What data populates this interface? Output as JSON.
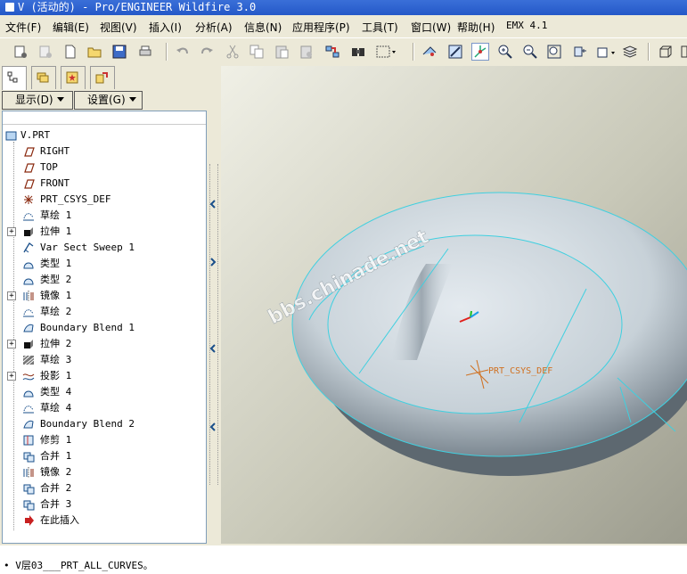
{
  "window": {
    "title": "V (活动的) - Pro/ENGINEER Wildfire 3.0"
  },
  "menu": [
    "文件(F)",
    "编辑(E)",
    "视图(V)",
    "插入(I)",
    "分析(A)",
    "信息(N)",
    "应用程序(P)",
    "工具(T)",
    "窗口(W)",
    "帮助(H)",
    "EMX 4.1"
  ],
  "toolbar": {
    "icons": [
      "new-session-icon",
      "open-file-disabled-icon",
      "new-file-icon",
      "open-folder-icon",
      "save-icon",
      "print-icon",
      "undo-icon",
      "redo-icon",
      "cut-icon",
      "copy-icon",
      "paste-icon",
      "paste-special-icon",
      "regenerate-icon",
      "find-icon",
      "select-box-icon",
      "refit-icon",
      "repaint-icon",
      "spin-center-icon",
      "zoom-in-icon",
      "zoom-out-icon",
      "zoom-fit-icon",
      "orient-icon",
      "saved-views-icon",
      "layers-icon",
      "display-style-icon"
    ],
    "pressed": "spin-center-icon"
  },
  "left_panel": {
    "tabs": [
      "model-tree-tab",
      "layer-tree-tab",
      "favorites-tab",
      "connections-tab"
    ],
    "display_label": "显示(D)",
    "settings_label": "设置(G)"
  },
  "tree": {
    "root": "V.PRT",
    "items": [
      {
        "label": "RIGHT",
        "icon": "datum-plane-icon",
        "expand": false
      },
      {
        "label": "TOP",
        "icon": "datum-plane-icon",
        "expand": false
      },
      {
        "label": "FRONT",
        "icon": "datum-plane-icon",
        "expand": false
      },
      {
        "label": "PRT_CSYS_DEF",
        "icon": "csys-icon",
        "expand": false
      },
      {
        "label": "草绘 1",
        "icon": "sketch-icon",
        "expand": false
      },
      {
        "label": "拉伸 1",
        "icon": "extrude-icon",
        "expand": true
      },
      {
        "label": "Var Sect Sweep 1",
        "icon": "sweep-icon",
        "expand": false
      },
      {
        "label": "类型 1",
        "icon": "surface-icon",
        "expand": false
      },
      {
        "label": "类型 2",
        "icon": "surface-icon",
        "expand": false
      },
      {
        "label": "镜像 1",
        "icon": "mirror-icon",
        "expand": true
      },
      {
        "label": "草绘 2",
        "icon": "sketch-icon",
        "expand": false
      },
      {
        "label": "Boundary Blend 1",
        "icon": "boundary-blend-icon",
        "expand": false
      },
      {
        "label": "拉伸 2",
        "icon": "extrude-icon",
        "expand": true
      },
      {
        "label": "草绘 3",
        "icon": "sketch-hatched-icon",
        "expand": false
      },
      {
        "label": "投影 1",
        "icon": "project-icon",
        "expand": true
      },
      {
        "label": "类型 4",
        "icon": "surface-icon",
        "expand": false
      },
      {
        "label": "草绘 4",
        "icon": "sketch-icon",
        "expand": false
      },
      {
        "label": "Boundary Blend 2",
        "icon": "boundary-blend-icon",
        "expand": false
      },
      {
        "label": "修剪 1",
        "icon": "trim-icon",
        "expand": false
      },
      {
        "label": "合并 1",
        "icon": "merge-icon",
        "expand": false
      },
      {
        "label": "镜像 2",
        "icon": "mirror-icon",
        "expand": false
      },
      {
        "label": "合并 2",
        "icon": "merge-icon",
        "expand": false
      },
      {
        "label": "合并 3",
        "icon": "merge-icon",
        "expand": false
      },
      {
        "label": "在此插入",
        "icon": "insert-here-icon",
        "expand": false
      }
    ]
  },
  "viewport": {
    "csys_label": "PRT_CSYS_DEF",
    "watermark": "bbs.chinade.net",
    "axis_colors": {
      "x": "#e0201c",
      "y": "#1cc020",
      "z": "#1c9ce8"
    }
  },
  "status": {
    "message": "• V层03___PRT_ALL_CURVES。"
  }
}
